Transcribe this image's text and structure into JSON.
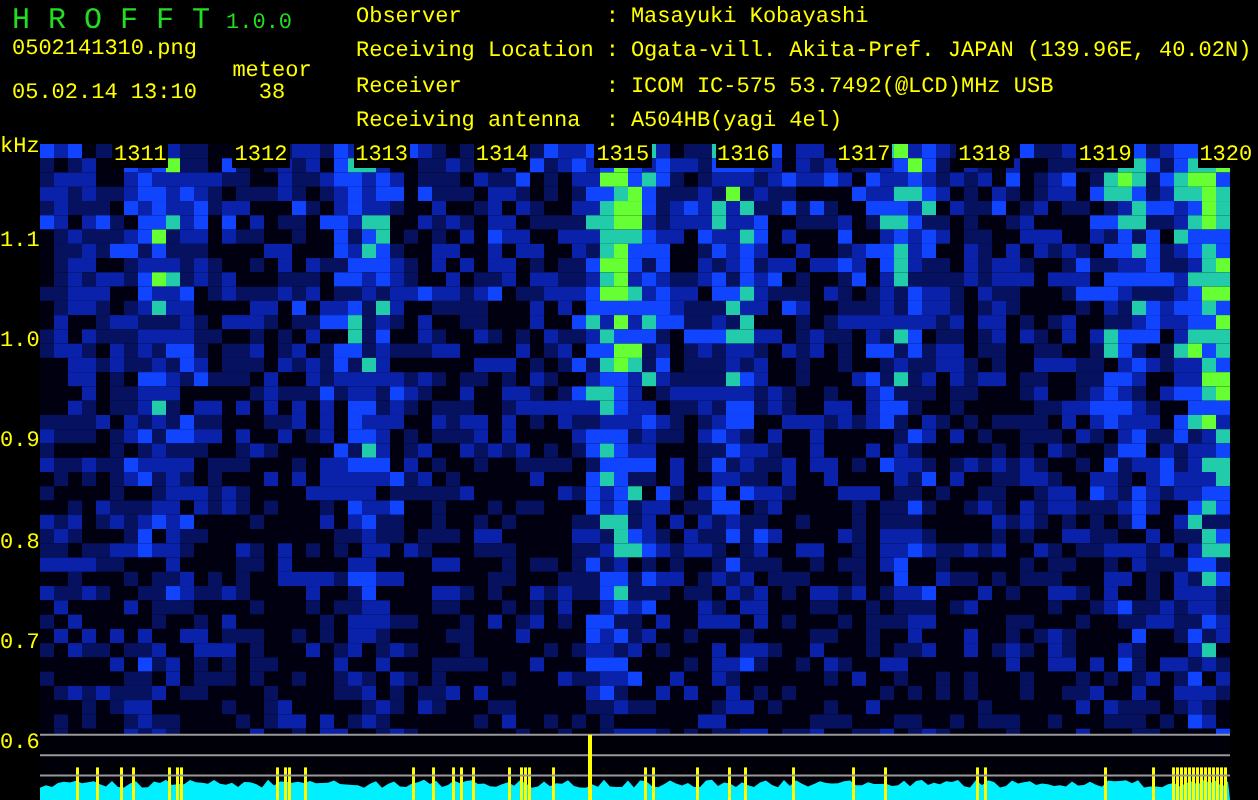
{
  "header": {
    "app_name": "H R O F F T",
    "version": "1.0.0",
    "file_name": "0502141310.png",
    "date_time": "05.02.14 13:10",
    "meteor_label": "meteor",
    "meteor_count": "38"
  },
  "info": [
    {
      "label": "Observer",
      "separator": ":",
      "value": "Masayuki Kobayashi"
    },
    {
      "label": "Receiving Location",
      "separator": ":",
      "value": "Ogata-vill. Akita-Pref. JAPAN (139.96E, 40.02N)"
    },
    {
      "label": "Receiver",
      "separator": ":",
      "value": "ICOM IC-575 53.7492(@LCD)MHz USB"
    },
    {
      "label": "Receiving antenna",
      "separator": ":",
      "value": "A504HB(yagi 4el)"
    }
  ],
  "plot": {
    "unit": "kHz",
    "y_labels": [
      "1.1",
      "1.0",
      "0.9",
      "0.8",
      "0.7",
      "0.6"
    ],
    "time_labels": [
      "1311",
      "1312",
      "1313",
      "1314",
      "1315",
      "1316",
      "1317",
      "1318",
      "1319",
      "1320"
    ]
  }
}
